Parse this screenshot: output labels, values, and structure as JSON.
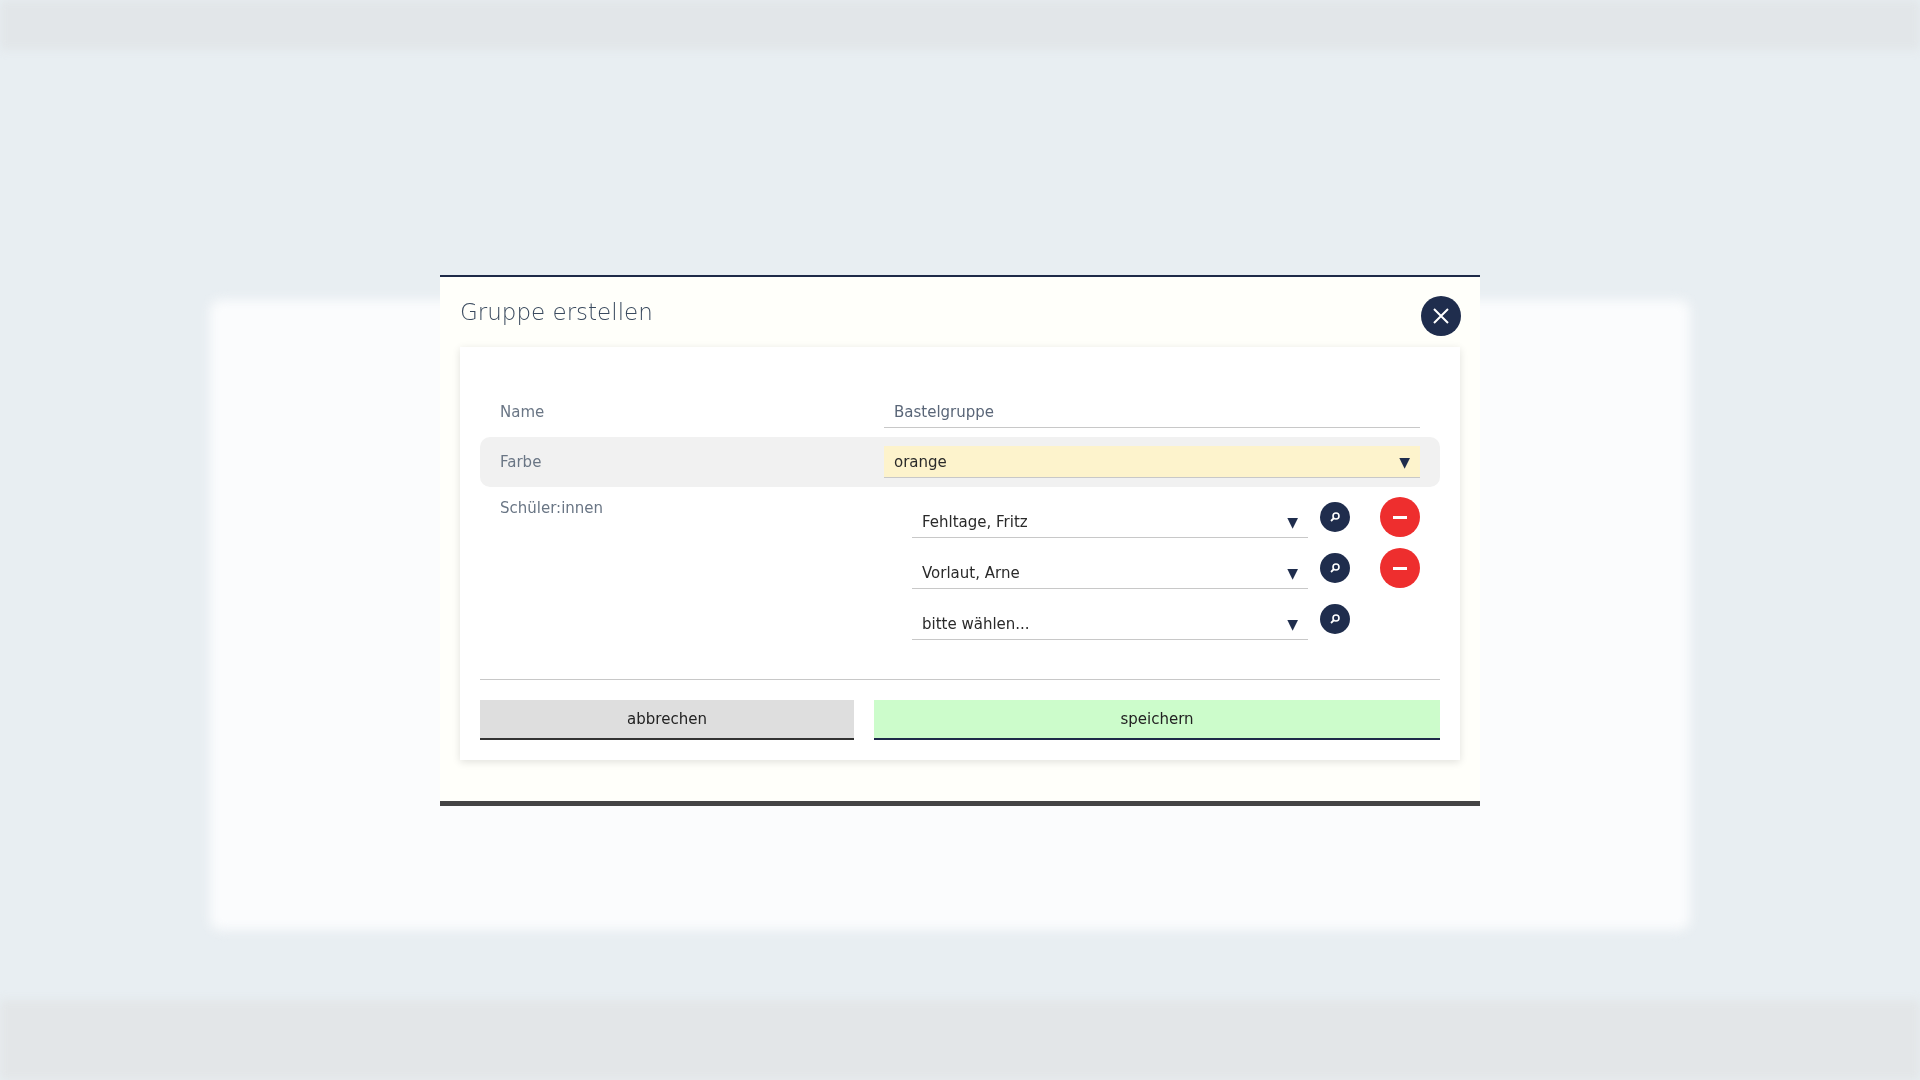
{
  "dialog": {
    "title": "Gruppe erstellen",
    "fields": [
      {
        "kind": "text",
        "label": "Name",
        "value": "Bastelgruppe",
        "highlighted": false
      },
      {
        "kind": "select",
        "label": "Farbe",
        "value": "orange",
        "highlighted": true
      }
    ],
    "students": {
      "label": "Schüler:innen",
      "rows": [
        {
          "value": "Fehltage, Fritz",
          "removable": true
        },
        {
          "value": "Vorlaut, Arne",
          "removable": true
        },
        {
          "value": "bitte wählen...",
          "removable": false
        }
      ]
    },
    "buttons": {
      "cancel": "abbrechen",
      "save": "speichern"
    },
    "select_arrow": "▼"
  }
}
